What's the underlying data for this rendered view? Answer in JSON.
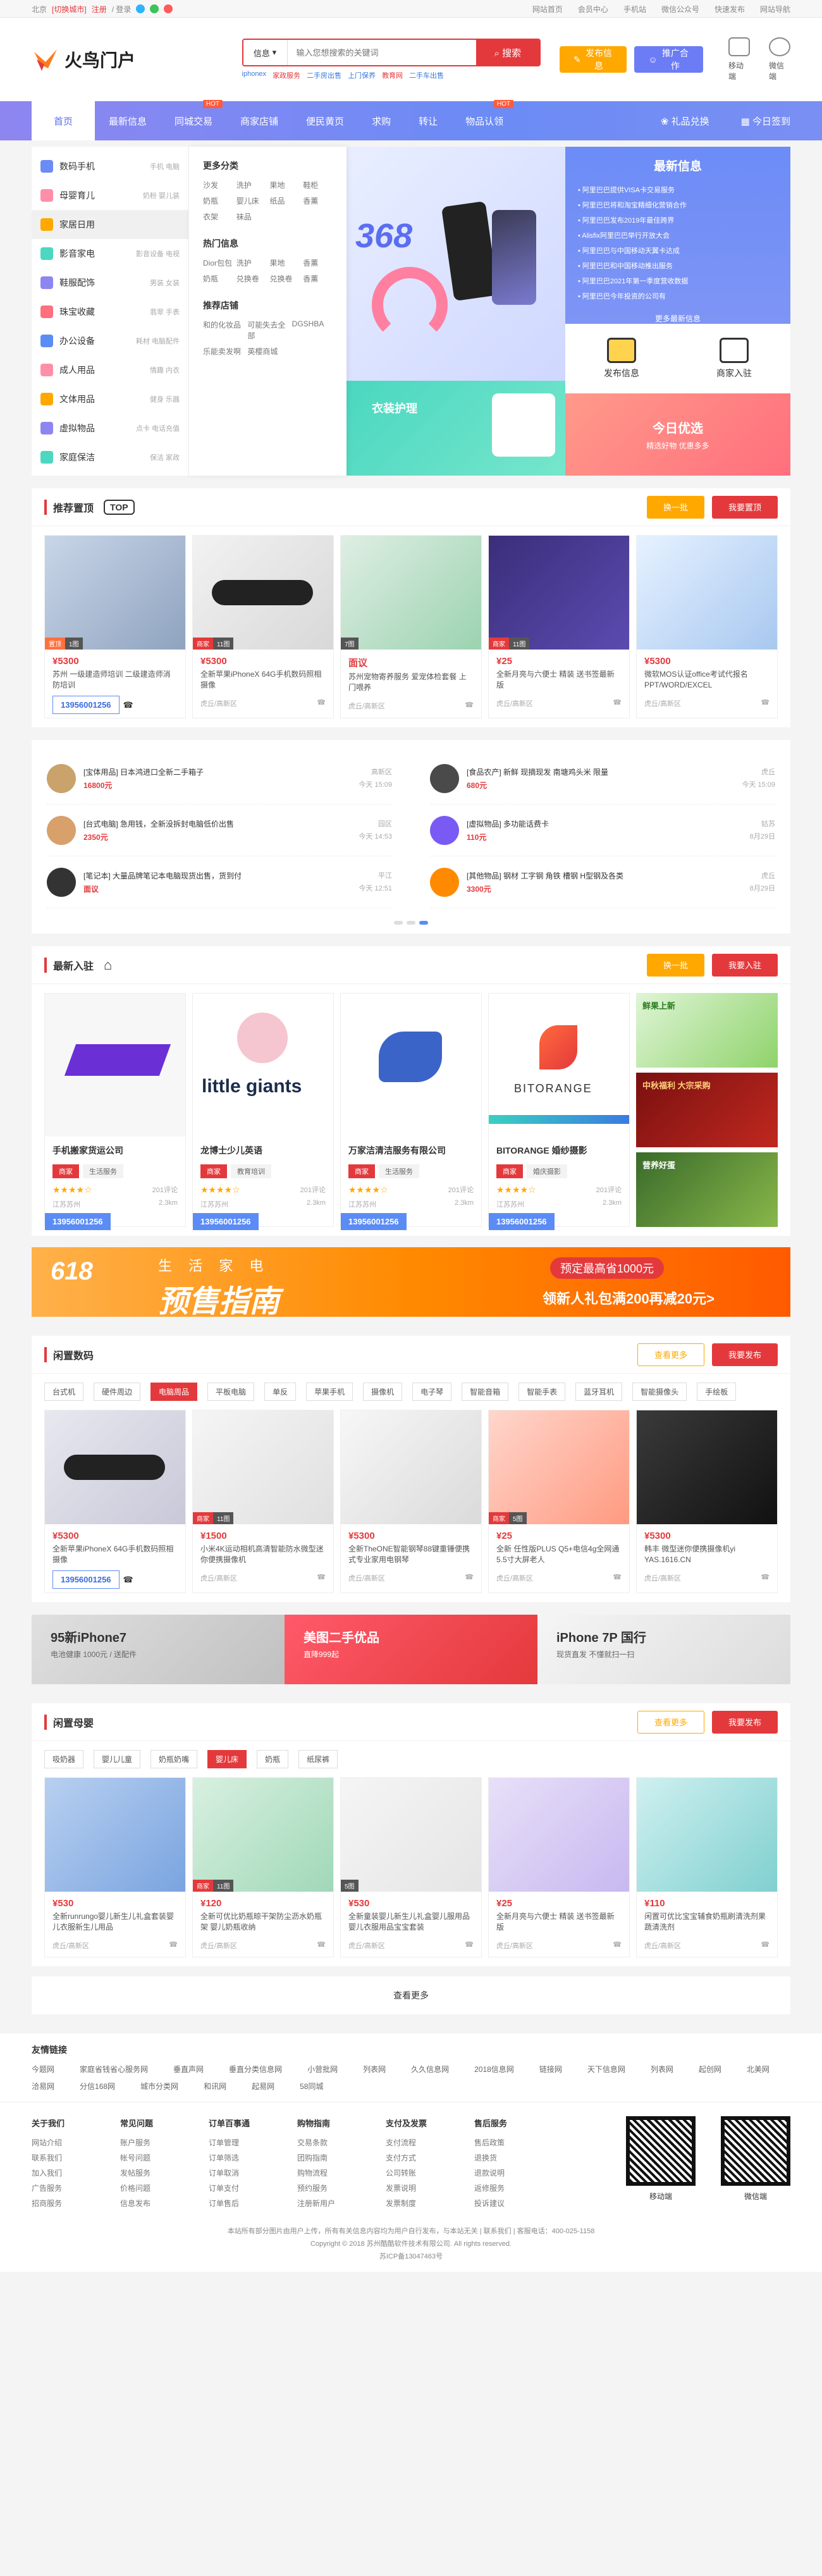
{
  "topbar": {
    "left": [
      "北京",
      "[切换城市]",
      "注册",
      "/ 登录"
    ],
    "right": [
      "网站首页",
      "会员中心",
      "手机站",
      "微信公众号",
      "快速发布",
      "网站导航"
    ]
  },
  "header": {
    "logo_text": "火鸟门户",
    "search_select": "信息",
    "search_placeholder": "输入您想搜索的关键词",
    "search_button": "搜索",
    "hot_words": [
      "iphonex",
      "家政服务",
      "二手房出售",
      "上门保养",
      "教育网",
      "二手车出售"
    ],
    "btn_publish": "发布信息",
    "btn_agent": "推广合作",
    "icon_mobile": "移动端",
    "icon_wechat": "微信端"
  },
  "nav": {
    "items": [
      "首页",
      "最新信息",
      "同城交易",
      "商家店铺",
      "便民黄页",
      "求购",
      "转让",
      "物品认领"
    ],
    "hot_label": "HOT",
    "right": [
      "礼品兑换",
      "今日签到"
    ]
  },
  "categories": [
    {
      "name": "数码手机",
      "sub": "手机 电脑"
    },
    {
      "name": "母婴育儿",
      "sub": "奶粉 婴儿装"
    },
    {
      "name": "家居日用",
      "sub": ""
    },
    {
      "name": "影音家电",
      "sub": "影音设备 电视"
    },
    {
      "name": "鞋服配饰",
      "sub": "男装 女装"
    },
    {
      "name": "珠宝收藏",
      "sub": "翡翠 手表"
    },
    {
      "name": "办公设备",
      "sub": "耗材 电脑配件"
    },
    {
      "name": "成人用品",
      "sub": "情趣 内衣"
    },
    {
      "name": "文体用品",
      "sub": "健身 乐器"
    },
    {
      "name": "虚拟物品",
      "sub": "点卡 电话充值"
    },
    {
      "name": "家庭保洁",
      "sub": "保洁 家政"
    }
  ],
  "submenu": {
    "h1": "更多分类",
    "g1": [
      "沙发",
      "洗护",
      "果地",
      "鞋柜",
      "奶瓶",
      "婴儿床",
      "纸品",
      "香薰",
      "衣架",
      "袜品"
    ],
    "h2": "热门信息",
    "g2": [
      "Dior包包",
      "洗护",
      "果地",
      "香薰",
      "奶瓶",
      "兑换卷",
      "兑换卷",
      "香薰"
    ],
    "h3": "推荐店铺",
    "g3": [
      "和的化妆品",
      "可能失去全部",
      "DGSHBA",
      "乐能卖发啊",
      "英樱商城"
    ]
  },
  "banner": {
    "main_text": "368",
    "small1": "衣装护理",
    "small2_title": "今日优选",
    "small2_sub": "精选好物 优惠多多"
  },
  "newinfo": {
    "title": "最新信息",
    "items": [
      "• 阿里巴巴提供VISA卡交易服务",
      "• 阿里巴巴将和淘宝精细化营销合作",
      "• 阿里巴巴发布2019年最佳跨界",
      "• Alisfix阿里巴巴举行开放大会",
      "• 阿里巴巴与中国移动天翼卡达成",
      "• 阿里巴巴和中国移动推出服务",
      "• 阿里巴巴2021年第一季度营收数据",
      "• 阿里巴巴今年投资的公司有"
    ],
    "more": "更多最新信息"
  },
  "actions": {
    "publish": "发布信息",
    "merchant": "商家入驻"
  },
  "recommend": {
    "title": "推荐置顶",
    "btn_change": "换一批",
    "btn_top": "我要置顶",
    "cards": [
      {
        "price": "¥5300",
        "desc": "苏州 一级建造师培训 二级建造师消防培训",
        "loc": "",
        "time": "",
        "phone": "13956001256",
        "tag1": "置顶",
        "tag2": "1图"
      },
      {
        "price": "¥5300",
        "desc": "全新苹果iPhoneX 64G手机数码照相摄像",
        "loc": "虎丘/高新区",
        "time": "今天 16:56",
        "tag1": "商家",
        "tag2": "11图"
      },
      {
        "price": "面议",
        "desc": "苏州宠物寄养服务 爱宠体检套餐 上门喂养",
        "loc": "虎丘/高新区",
        "time": "今天 16:56",
        "tag1": "7图",
        "tag2": ""
      },
      {
        "price": "¥25",
        "desc": "全新月亮与六便士 精装 送书签最新版",
        "loc": "虎丘/高新区",
        "time": "今天 16:56",
        "tag1": "商家",
        "tag2": "11图"
      },
      {
        "price": "¥5300",
        "desc": "微软MOS认证office考试代报名PPT/WORD/EXCEL",
        "loc": "虎丘/高新区",
        "time": "今天 16:56",
        "tag1": "",
        "tag2": ""
      }
    ]
  },
  "news": [
    {
      "title": "[宝体用品] 日本鸿进口全新二手箱子",
      "price": "16800元",
      "area": "高新区",
      "time": "今天 15:09"
    },
    {
      "title": "[食品农产] 新鲜 现摘现发 南塘鸡头米 限量",
      "price": "680元",
      "area": "虎丘",
      "time": "今天 15:09"
    },
    {
      "title": "[台式电脑] 急用钱，全新没拆封电脑低价出售",
      "price": "2350元",
      "area": "园区",
      "time": "今天 14:53"
    },
    {
      "title": "[虚拟物品] 多功能话费卡",
      "price": "110元",
      "area": "姑苏",
      "time": "8月29日"
    },
    {
      "title": "[笔记本] 大量品牌笔记本电脑现货出售，货到付",
      "price": "面议",
      "area": "平江",
      "time": "今天 12:51"
    },
    {
      "title": "[其他物品] 钢材 工字钢 角铁 槽钢 H型钢及各类",
      "price": "3300元",
      "area": "虎丘",
      "time": "8月29日"
    }
  ],
  "newjoin": {
    "title": "最新入驻",
    "btn_change": "换一批",
    "btn_join": "我要入驻",
    "companies": [
      {
        "name": "手机搬家货运公司",
        "tags": [
          "商家",
          "生活服务"
        ],
        "reviews": "201评论",
        "loc": "江苏苏州",
        "dist": "2.3km",
        "phone": "13956001256"
      },
      {
        "name": "龙博士少儿英语",
        "tags": [
          "商家",
          "教育培训"
        ],
        "reviews": "201评论",
        "loc": "江苏苏州",
        "dist": "2.3km",
        "phone": "13956001256",
        "logo": "little giants"
      },
      {
        "name": "万家洁清洁服务有限公司",
        "tags": [
          "商家",
          "生活服务"
        ],
        "reviews": "201评论",
        "loc": "江苏苏州",
        "dist": "2.3km",
        "phone": "13956001256"
      },
      {
        "name": "BITORANGE 婚纱摄影",
        "tags": [
          "商家",
          "婚庆摄影"
        ],
        "reviews": "201评论",
        "loc": "江苏苏州",
        "dist": "2.3km",
        "phone": "13956001256",
        "logo": "BITORANGE"
      }
    ],
    "side_ads": [
      "鲜果上新",
      "中秋福利 大宗采购",
      "营养好蛋"
    ]
  },
  "ad618": {
    "nums": "618",
    "words": "生 活 家 电",
    "title": "预售指南",
    "right_top": "预定最高省1000元",
    "right_bottom": "领新人礼包满200再减20元>"
  },
  "digital": {
    "title": "闲置数码",
    "btn_view": "查看更多",
    "btn_post": "我要发布",
    "filters": [
      "台式机",
      "硬件周边",
      "电脑周品",
      "平板电脑",
      "单反",
      "苹果手机",
      "摄像机",
      "电子琴",
      "智能音箱",
      "智能手表",
      "蓝牙耳机",
      "智能摄像头",
      "手绘板"
    ],
    "cards": [
      {
        "price": "¥5300",
        "desc": "全新苹果iPhoneX 64G手机数码照相摄像",
        "phone": "13956001256",
        "loc": "",
        "time": "",
        "tag1": "",
        "tag2": ""
      },
      {
        "price": "¥1500",
        "desc": "小米4K运动相机高清智能防水微型迷你便携摄像机",
        "loc": "虎丘/高新区",
        "time": "今天 16:56",
        "tag1": "商家",
        "tag2": "11图"
      },
      {
        "price": "¥5300",
        "desc": "全新TheONE智能钢琴88键重锤便携式专业家用电钢琴",
        "loc": "虎丘/高新区",
        "time": "今天 16:56",
        "tag1": "",
        "tag2": ""
      },
      {
        "price": "¥25",
        "desc": "全新 任性版PLUS Q5+电信4g全网通5.5寸大屏老人",
        "loc": "虎丘/高新区",
        "time": "今天 16:56",
        "tag1": "商家",
        "tag2": "5图"
      },
      {
        "price": "¥5300",
        "desc": "韩丰 微型迷你便携摄像机yi YAS.1616.CN",
        "loc": "虎丘/高新区",
        "time": "今天 16:56",
        "tag1": "",
        "tag2": ""
      }
    ]
  },
  "promo": [
    {
      "title": "95新iPhone7",
      "sub": "电池健康 1000元 / 送配件"
    },
    {
      "title": "美图二手优品",
      "sub": "直降999起"
    },
    {
      "title": "iPhone 7P 国行",
      "sub": "现货直发 不懂就扫一扫"
    }
  ],
  "baby": {
    "title": "闲置母婴",
    "btn_view": "查看更多",
    "btn_post": "我要发布",
    "filters": [
      "吸奶器",
      "婴儿儿童",
      "奶瓶奶嘴",
      "婴儿床",
      "奶瓶",
      "纸尿裤"
    ],
    "cards": [
      {
        "price": "¥530",
        "desc": "全新runrungo婴儿新生儿礼盒套装婴儿衣服新生儿用品",
        "loc": "虎丘/高新区",
        "time": "今天 14:53"
      },
      {
        "price": "¥120",
        "desc": "全新可优比奶瓶晾干架防尘沥水奶瓶架 婴儿奶瓶收纳",
        "loc": "虎丘/高新区",
        "time": "今天 16:56",
        "tag1": "商家",
        "tag2": "11图"
      },
      {
        "price": "¥530",
        "desc": "全新童装婴儿新生儿礼盒婴儿服用品 婴儿衣服用品宝宝套装",
        "loc": "虎丘/高新区",
        "time": "今天 16:56",
        "tag1": "5图"
      },
      {
        "price": "¥25",
        "desc": "全新月亮与六便士 精装 送书签最新版",
        "loc": "虎丘/高新区",
        "time": "今天 16:56"
      },
      {
        "price": "¥110",
        "desc": "闲置可优比宝宝辅食奶瓶刷清洗剂果蔬清洗剂",
        "loc": "虎丘/高新区",
        "time": "今天 16:56"
      }
    ]
  },
  "loadmore": "查看更多",
  "links": {
    "title": "友情链接",
    "items": [
      "今题网",
      "家庭省钱省心服务网",
      "垂直声网",
      "垂直分类信息网",
      "小营批网",
      "列表网",
      "久久信息网",
      "2018信息网",
      "链接网",
      "天下信息网",
      "列表网",
      "起创网",
      "北美网",
      "洽易网",
      "分信168网",
      "城市分类网",
      "和讯网",
      "起易网",
      "58同城"
    ]
  },
  "footer": {
    "cols": [
      {
        "h": "关于我们",
        "items": [
          "网站介绍",
          "联系我们",
          "加入我们",
          "广告服务",
          "招商服务"
        ]
      },
      {
        "h": "常见问题",
        "items": [
          "账户服务",
          "帐号问题",
          "发帖服务",
          "价格问题",
          "信息发布"
        ]
      },
      {
        "h": "订单百事通",
        "items": [
          "订单管理",
          "订单筛选",
          "订单取消",
          "订单支付",
          "订单售后"
        ]
      },
      {
        "h": "购物指南",
        "items": [
          "交易条款",
          "团购指南",
          "购物流程",
          "预约服务",
          "注册新用户"
        ]
      },
      {
        "h": "支付及发票",
        "items": [
          "支付流程",
          "支付方式",
          "公司转账",
          "发票说明",
          "发票制度"
        ]
      },
      {
        "h": "售后服务",
        "items": [
          "售后政策",
          "退换货",
          "退款说明",
          "返修服务",
          "投诉建议"
        ]
      }
    ],
    "qr1": "移动端",
    "qr2": "微信端",
    "copy1": "本站所有部分图片由用户上传，所有有关信息内容均为用户自行发布，与本站无关 | 联系我们 | 客服电话：400-025-1158",
    "copy2": "Copyright © 2018 苏州酷酷软件技术有限公司. All rights reserved.",
    "copy3": "苏ICP备13047463号"
  }
}
